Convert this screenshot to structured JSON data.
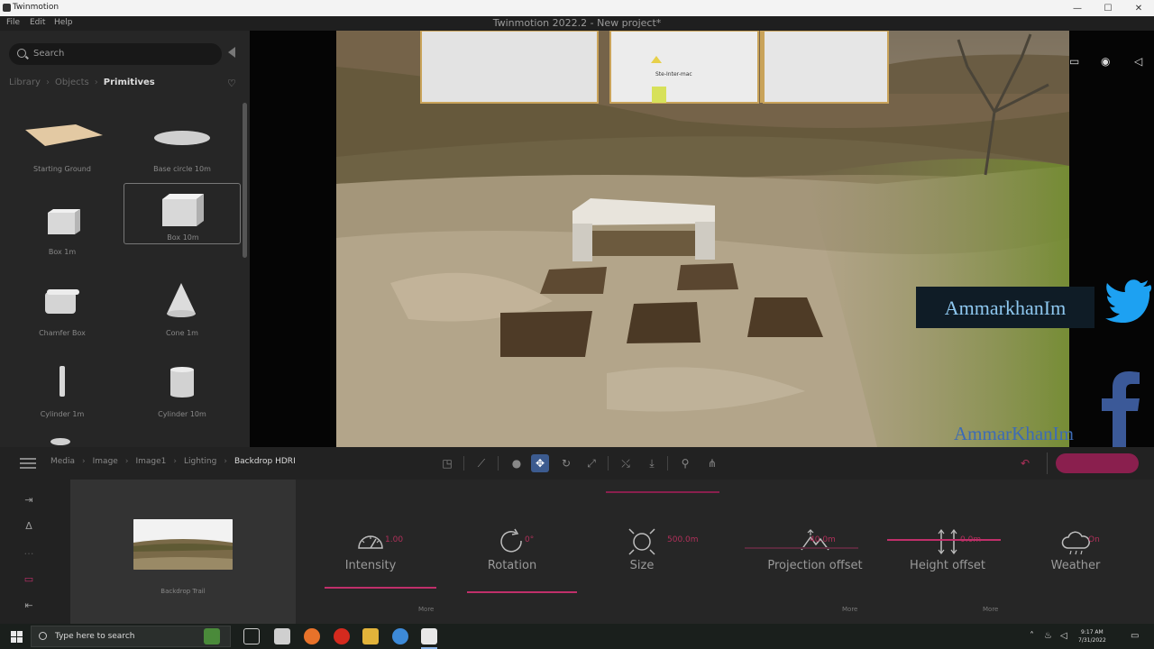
{
  "window": {
    "app_name": "Twinmotion",
    "title": "Twinmotion 2022.2 - New project*",
    "minimize": "—",
    "maximize": "☐",
    "close": "✕"
  },
  "menu": [
    "File",
    "Edit",
    "Help"
  ],
  "library": {
    "search_placeholder": "Search",
    "breadcrumb": [
      "Library",
      "Objects",
      "Primitives"
    ],
    "favorites_icon": "♡",
    "items": [
      {
        "label": "Starting Ground",
        "shape": "ground"
      },
      {
        "label": "Base circle 10m",
        "shape": "disc"
      },
      {
        "label": "Box 1m",
        "shape": "cube-small"
      },
      {
        "label": "Box 10m",
        "shape": "cube-large"
      },
      {
        "label": "Chamfer Box",
        "shape": "chamfer"
      },
      {
        "label": "Cone 1m",
        "shape": "cone"
      },
      {
        "label": "Cylinder 1m",
        "shape": "cyl-thin"
      },
      {
        "label": "Cylinder 10m",
        "shape": "cyl"
      }
    ]
  },
  "viewport": {
    "marker_label": "Ste-Inter-mac",
    "tools": [
      "▭",
      "◉",
      "◁"
    ]
  },
  "toolbar": {
    "breadcrumb": [
      "Media",
      "Image",
      "Image1",
      "Lighting",
      "Backdrop HDRI"
    ],
    "icons": [
      "◳",
      "⟋",
      "●",
      "✥",
      "↻",
      "⤢",
      "⤯",
      "⤓",
      "⚲",
      "⋔"
    ],
    "undo": "↶"
  },
  "sidebar": {
    "icons": [
      "⇥",
      "Δ",
      "…",
      "▭",
      "⇤"
    ]
  },
  "hdri": {
    "label": "Backdrop Trail"
  },
  "params": [
    {
      "name": "Intensity",
      "value": "1.00",
      "icon": "gauge"
    },
    {
      "name": "Rotation",
      "value": "0°",
      "icon": "rotate"
    },
    {
      "name": "Size",
      "value": "500.0m",
      "icon": "size"
    },
    {
      "name": "Projection offset",
      "value": "40.0m",
      "icon": "mountain"
    },
    {
      "name": "Height offset",
      "value": "0.0m",
      "icon": "height"
    },
    {
      "name": "Weather",
      "value": "On",
      "icon": "cloud"
    }
  ],
  "more_label": "More",
  "taskbar": {
    "search_placeholder": "Type here to search",
    "time": "9:17 AM",
    "date": "7/31/2022"
  },
  "watermark": {
    "twitter": "AmmarkhanIm",
    "facebook": "AmmarKhanIm"
  },
  "colors": {
    "accent": "#c02f6a",
    "accent_dark": "#8a1f4e",
    "active_tool": "#3c5b8f",
    "twitter": "#1da1f2",
    "facebook": "#3b5998"
  }
}
